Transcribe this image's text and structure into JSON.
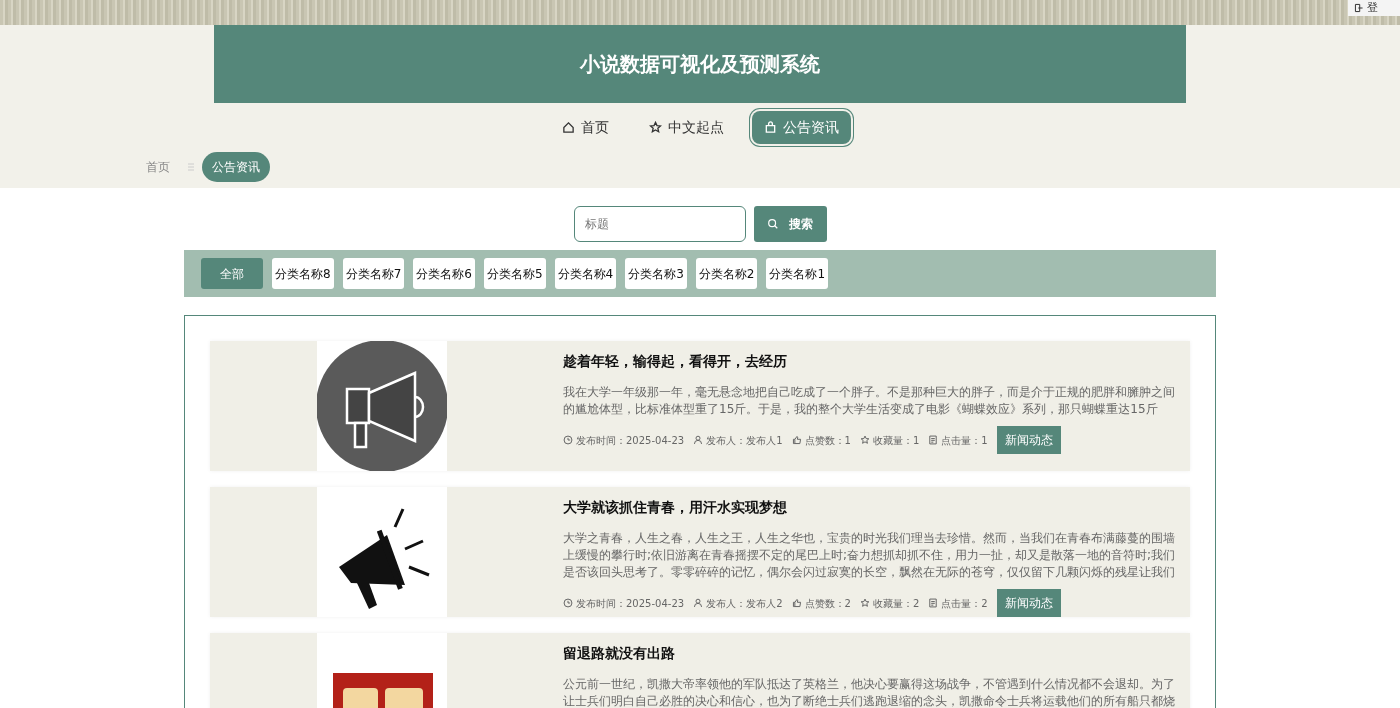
{
  "top_button": {
    "label": "登"
  },
  "header": {
    "title": "小说数据可视化及预测系统"
  },
  "nav": [
    {
      "label": "首页",
      "selected": false
    },
    {
      "label": "中文起点",
      "selected": false
    },
    {
      "label": "公告资讯",
      "selected": true
    }
  ],
  "breadcrumb": [
    {
      "label": "首页",
      "selected": false
    },
    {
      "label": "公告资讯",
      "selected": true
    }
  ],
  "search": {
    "placeholder": "标题",
    "button": "搜索"
  },
  "categories": [
    {
      "label": "全部",
      "selected": true
    },
    {
      "label": "分类名称8",
      "selected": false
    },
    {
      "label": "分类名称7",
      "selected": false
    },
    {
      "label": "分类名称6",
      "selected": false
    },
    {
      "label": "分类名称5",
      "selected": false
    },
    {
      "label": "分类名称4",
      "selected": false
    },
    {
      "label": "分类名称3",
      "selected": false
    },
    {
      "label": "分类名称2",
      "selected": false
    },
    {
      "label": "分类名称1",
      "selected": false
    }
  ],
  "news": [
    {
      "title": "趁着年轻，输得起，看得开，去经历",
      "summary": "我在大学一年级那一年，毫无悬念地把自己吃成了一个胖子。不是那种巨大的胖子，而是介于正规的肥胖和臃肿之间的尴尬体型，比标准体型重了15斤。于是，我的整个大学生活变成了电影《蝴蝶效应》系列，那只蝴蝶重达15斤",
      "meta": [
        "发布时间：2025-04-23",
        "发布人：发布人1",
        "点赞数：1",
        "收藏量：1",
        "点击量：1"
      ],
      "tag": "新闻动态"
    },
    {
      "title": "大学就该抓住青春，用汗水实现梦想",
      "summary": "大学之青春，人生之春，人生之王，人生之华也，宝贵的时光我们理当去珍惜。然而，当我们在青春布满藤蔓的围墙上缓慢的攀行时;依旧游离在青春摇摆不定的尾巴上时;奋力想抓却抓不住，用力一扯，却又是散落一地的音符时;我们是否该回头思考了。零零碎碎的记忆，偶尔会闪过寂寞的长空，飘然在无际的苍穹，仅仅留下几颗闪烁的残星让我们",
      "meta": [
        "发布时间：2025-04-23",
        "发布人：发布人2",
        "点赞数：2",
        "收藏量：2",
        "点击量：2"
      ],
      "tag": "新闻动态"
    },
    {
      "title": "留退路就没有出路",
      "summary": "公元前一世纪，凯撒大帝率领他的军队抵达了英格兰，他决心要赢得这场战争，不管遇到什么情况都不会退却。为了让士兵们明白自己必胜的决心和信心，也为了断绝士兵们逃跑退缩的念头，凯撒命令士兵将运载他们的所有船只都烧"
    }
  ]
}
